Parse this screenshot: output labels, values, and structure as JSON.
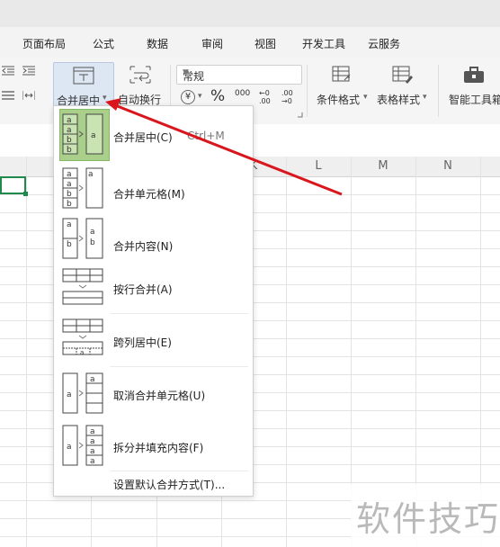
{
  "tabs": [
    "页面布局",
    "公式",
    "数据",
    "审阅",
    "视图",
    "开发工具",
    "云服务"
  ],
  "ribbon": {
    "merge_center": "合并居中",
    "merge_center_arrow": "▾",
    "wrap_text": "自动换行",
    "number_format": "常规",
    "currency_symbol": "¥",
    "percent_symbol": "%",
    "thousands_symbol": "000",
    "inc_decimal": "←0 .00",
    "dec_decimal": ".00 →0",
    "cond_format": "条件格式",
    "table_style": "表格样式",
    "smart_toolbox": "智能工具箱"
  },
  "columns": [
    "K",
    "L",
    "M",
    "N"
  ],
  "menu": {
    "items": [
      {
        "label": "合并居中(C)",
        "shortcut": "Ctrl+M",
        "icon": "merge-center-icon",
        "active": true
      },
      {
        "label": "合并单元格(M)",
        "shortcut": "",
        "icon": "merge-cells-icon"
      },
      {
        "label": "合并内容(N)",
        "shortcut": "",
        "icon": "merge-content-icon"
      },
      {
        "label": "按行合并(A)",
        "shortcut": "",
        "icon": "merge-by-row-icon"
      },
      {
        "label": "跨列居中(E)",
        "shortcut": "",
        "icon": "center-across-icon"
      },
      {
        "label": "取消合并单元格(U)",
        "shortcut": "",
        "icon": "unmerge-icon"
      },
      {
        "label": "拆分并填充内容(F)",
        "shortcut": "",
        "icon": "split-fill-icon"
      }
    ],
    "default_setting": "设置默认合并方式(T)..."
  },
  "icon_letters": {
    "a": "a",
    "b": "b"
  },
  "watermark": "软件技巧",
  "colors": {
    "accent_green": "#1f8a4c",
    "highlight": "#a9cf8a",
    "arrow_red": "#d9161c"
  }
}
